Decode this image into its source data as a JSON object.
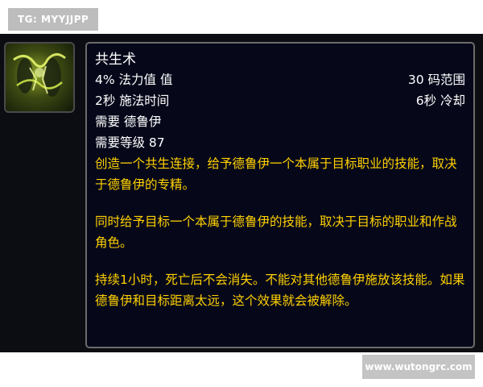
{
  "watermark_top": "TG: MYYJJPP",
  "watermark_bottom": "www.wutongrc.com",
  "icon": "symbiosis-spell-icon",
  "colors": {
    "background": "#0c0d12",
    "tooltip_bg": "#06081a",
    "tooltip_border": "#6b6b6b",
    "text_white": "#ffffff",
    "text_yellow": "#ffd100"
  },
  "tooltip": {
    "title": "共生术",
    "cost": "4% 法力值 值",
    "range": "30 码范围",
    "cast_time": "2秒 施法时间",
    "cooldown": "6秒 冷却",
    "requires_class": "需要 德鲁伊",
    "requires_level": "需要等级 87",
    "description": [
      "创造一个共生连接，给予德鲁伊一个本属于目标职业的技能，取决于德鲁伊的专精。",
      "同时给予目标一个本属于德鲁伊的技能，取决于目标的职业和作战角色。",
      "持续1小时，死亡后不会消失。不能对其他德鲁伊施放该技能。如果德鲁伊和目标距离太远，这个效果就会被解除。"
    ]
  }
}
